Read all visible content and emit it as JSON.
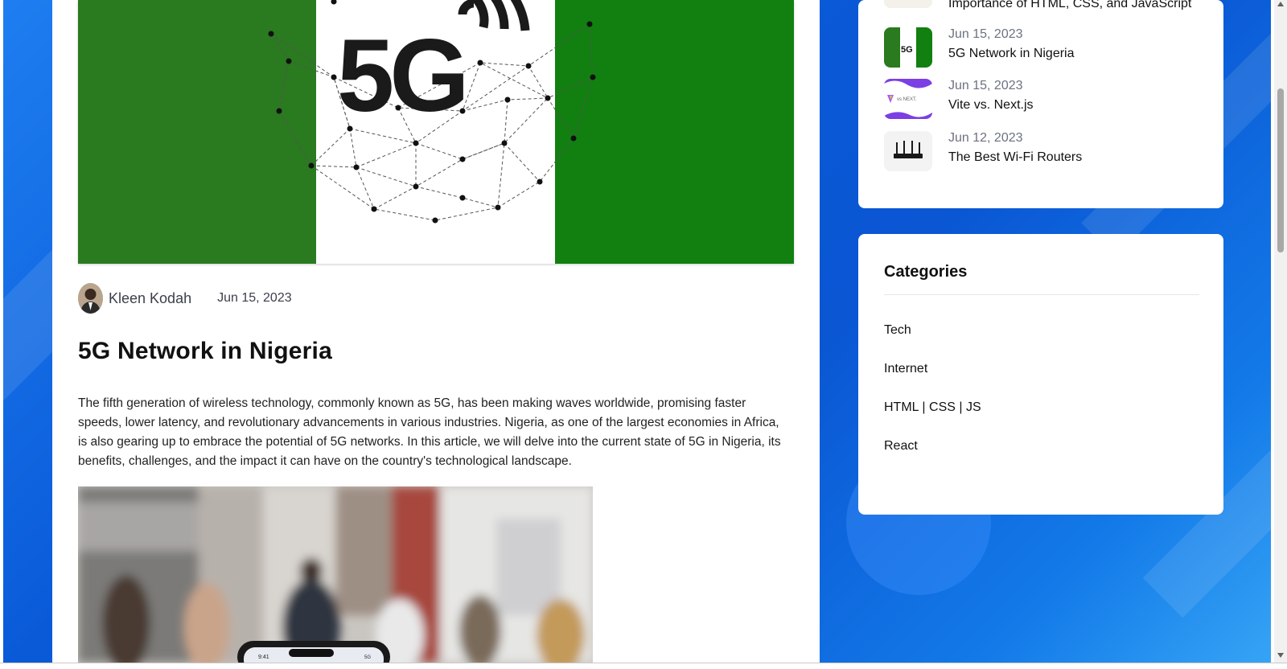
{
  "colors": {
    "brand_blue": "#0a56d3",
    "nigeria_green": "#2a7a1f",
    "card_bg": "#ffffff",
    "muted_text": "#6b7280"
  },
  "hero": {
    "image_text": "5G"
  },
  "post": {
    "author": "Kleen Kodah",
    "date": "Jun 15, 2023",
    "title": "5G Network in Nigeria",
    "body": "The fifth generation of wireless technology, commonly known as 5G, has been making waves worldwide, promising faster speeds, lower latency, and revolutionary advancements in various industries. Nigeria, as one of the largest economies in Africa, is also gearing up to embrace the potential of 5G networks. In this article, we will delve into the current state of 5G in Nigeria, its benefits, challenges, and the impact it can have on the country's technological landscape.",
    "photo_phone_time": "9:41",
    "photo_phone_signal": "5G"
  },
  "recent_posts": {
    "cut_off_title": "Importance of HTML, CSS, and JavaScript",
    "items": [
      {
        "date": "Jun 15, 2023",
        "title": "5G Network in Nigeria",
        "thumb_text": "5G"
      },
      {
        "date": "Jun 15, 2023",
        "title": "Vite vs. Next.js",
        "thumb_text": "vs NEXT."
      },
      {
        "date": "Jun 12, 2023",
        "title": "The Best Wi-Fi Routers",
        "thumb_text": ""
      }
    ]
  },
  "categories": {
    "title": "Categories",
    "items": [
      "Tech",
      "Internet",
      "HTML | CSS | JS",
      "React"
    ]
  }
}
